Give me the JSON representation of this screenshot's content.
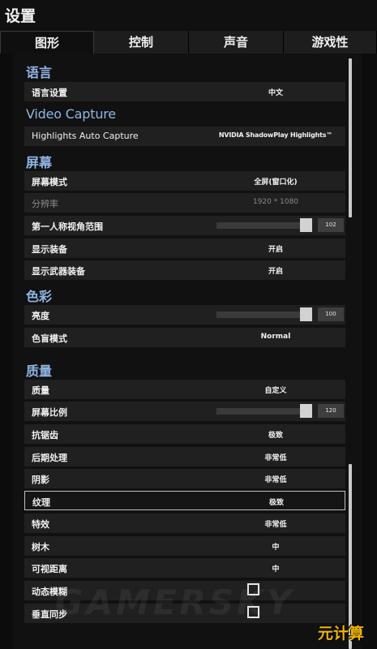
{
  "window": {
    "title": "设置"
  },
  "tabs": [
    {
      "label": "图形",
      "active": true
    },
    {
      "label": "控制",
      "active": false
    },
    {
      "label": "声音",
      "active": false
    },
    {
      "label": "游戏性",
      "active": false
    }
  ],
  "sections": {
    "language": "语言",
    "video_capture": "Video Capture",
    "screen": "屏幕",
    "color": "色彩",
    "quality": "质量"
  },
  "rows": {
    "language_setting": {
      "label": "语言设置",
      "value": "中文"
    },
    "highlights": {
      "label": "Highlights Auto Capture",
      "value": "NVIDIA ShadowPlay Highlights™"
    },
    "screen_mode": {
      "label": "屏幕模式",
      "value": "全屏(窗口化)"
    },
    "resolution": {
      "label": "分辨率",
      "value": "1920 * 1080"
    },
    "fov": {
      "label": "第一人称视角范围",
      "value": "102",
      "level": 1.0
    },
    "show_equipment": {
      "label": "显示装备",
      "value": "开启"
    },
    "show_weapon_equipment": {
      "label": "显示武器装备",
      "value": "开启"
    },
    "brightness": {
      "label": "亮度",
      "value": "100",
      "level": 1.0
    },
    "colorblind": {
      "label": "色盲模式",
      "value": "Normal"
    },
    "quality": {
      "label": "质量",
      "value": "自定义"
    },
    "screen_scale": {
      "label": "屏幕比例",
      "value": "120",
      "level": 1.0
    },
    "antialiasing": {
      "label": "抗锯齿",
      "value": "极致"
    },
    "post_processing": {
      "label": "后期处理",
      "value": "非常低"
    },
    "shadows": {
      "label": "阴影",
      "value": "非常低"
    },
    "textures": {
      "label": "纹理",
      "value": "极致"
    },
    "effects": {
      "label": "特效",
      "value": "非常低"
    },
    "foliage": {
      "label": "树木",
      "value": "中"
    },
    "view_distance": {
      "label": "可视距离",
      "value": "中"
    },
    "motion_blur": {
      "label": "动态模糊",
      "checked": false
    },
    "vsync": {
      "label": "垂直同步",
      "checked": false
    }
  },
  "watermark": "GAMERSKY",
  "logo": "元计算"
}
